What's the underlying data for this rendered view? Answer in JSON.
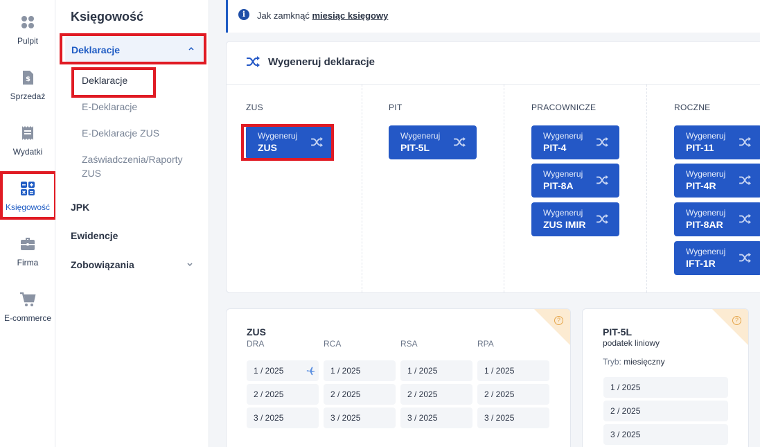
{
  "rail": {
    "items": [
      {
        "label": "Pulpit",
        "icon": "dashboard-icon"
      },
      {
        "label": "Sprzedaż",
        "icon": "invoice-icon"
      },
      {
        "label": "Wydatki",
        "icon": "receipt-icon"
      },
      {
        "label": "Księgowość",
        "icon": "calculator-icon"
      },
      {
        "label": "Firma",
        "icon": "briefcase-icon"
      },
      {
        "label": "E-commerce",
        "icon": "cart-icon"
      }
    ]
  },
  "subnav": {
    "title": "Księgowość",
    "group_label": "Deklaracje",
    "items": [
      "Deklaracje",
      "E-Deklaracje",
      "E-Deklaracje ZUS",
      "Zaświadczenia/Raporty",
      "ZUS"
    ],
    "top_items": [
      "JPK",
      "Ewidencje",
      "Zobowiązania"
    ]
  },
  "info": {
    "prefix": "Jak zamknąć",
    "link": "miesiąc księgowy"
  },
  "generate": {
    "title": "Wygeneruj deklaracje",
    "btn_prefix": "Wygeneruj",
    "columns": [
      {
        "title": "ZUS",
        "buttons": [
          "ZUS"
        ]
      },
      {
        "title": "PIT",
        "buttons": [
          "PIT-5L"
        ]
      },
      {
        "title": "PRACOWNICZE",
        "buttons": [
          "PIT-4",
          "PIT-8A",
          "ZUS IMIR"
        ]
      },
      {
        "title": "ROCZNE",
        "buttons": [
          "PIT-11",
          "PIT-4R",
          "PIT-8AR",
          "IFT-1R"
        ]
      }
    ]
  },
  "zus_card": {
    "title": "ZUS",
    "help": "?",
    "columns": [
      "DRA",
      "RCA",
      "RSA",
      "RPA"
    ],
    "periods": [
      "1 / 2025",
      "2 / 2025",
      "3 / 2025"
    ]
  },
  "pit_card": {
    "title": "PIT-5L",
    "subtitle": "podatek liniowy",
    "help": "?",
    "mode_label": "Tryb:",
    "mode_value": "miesięczny",
    "periods": [
      "1 / 2025",
      "2 / 2025",
      "3 / 2025"
    ]
  },
  "colors": {
    "accent": "#2458c6",
    "highlight": "#e01b24",
    "corner": "#fcebd2"
  }
}
